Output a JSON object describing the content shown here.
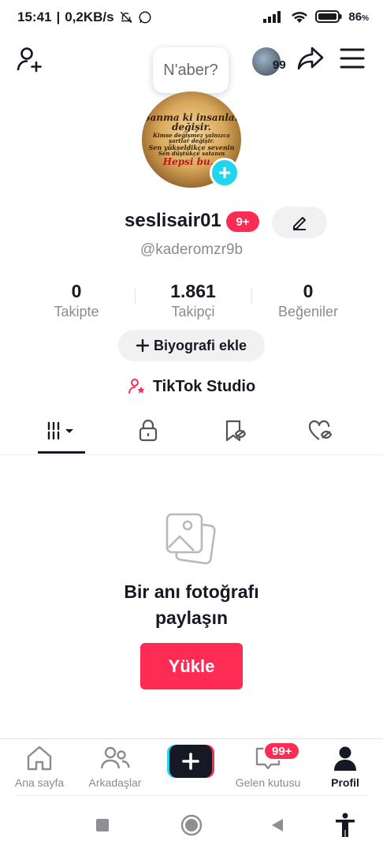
{
  "status_bar": {
    "time": "15:41",
    "speed": "0,2KB/s",
    "battery": "86"
  },
  "header": {
    "note": "N'aber?",
    "mini_badge": "99"
  },
  "avatar_text": {
    "line1": "Sanma ki insanlar",
    "line2": "değişir.",
    "line3": "Kimse değişmez yalnızca",
    "line4": "şartlar değişir.",
    "line5": "Sen yükseldikçe sevenin",
    "line6": "Sen düştükçe satanın",
    "line7": "Hepsi bu..."
  },
  "profile": {
    "username": "seslisair01",
    "username_badge": "9+",
    "handle": "@kaderomzr9b"
  },
  "stats": [
    {
      "value": "0",
      "label": "Takipte"
    },
    {
      "value": "1.861",
      "label": "Takipçi"
    },
    {
      "value": "0",
      "label": "Beğeniler"
    }
  ],
  "bio_button": "Biyografi ekle",
  "studio_label": "TikTok Studio",
  "empty_state": {
    "line1": "Bir anı fotoğrafı",
    "line2": "paylaşın",
    "button": "Yükle"
  },
  "bottom_nav": {
    "home": "Ana sayfa",
    "friends": "Arkadaşlar",
    "inbox": "Gelen kutusu",
    "inbox_badge": "99+",
    "profile": "Profil"
  },
  "colors": {
    "accent": "#fe2c55",
    "cyan": "#20d5ec",
    "text": "#161823",
    "muted": "#8a8b91"
  }
}
